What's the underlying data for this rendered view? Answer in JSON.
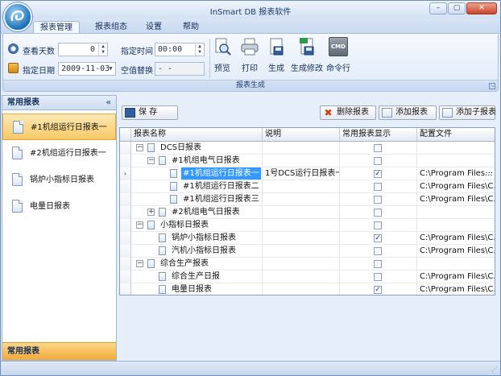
{
  "window": {
    "title": "InSmart DB 报表软件",
    "min": "–",
    "max": "▢",
    "close": "✕"
  },
  "ribbon": {
    "tabs": [
      {
        "label": "报表管理",
        "active": true
      },
      {
        "label": "报表组态",
        "active": false
      },
      {
        "label": "设置",
        "active": false
      },
      {
        "label": "帮助",
        "active": false
      }
    ],
    "group_label": "报表生成",
    "query_days_label": "查看天数",
    "query_days_value": "0",
    "date_label": "指定日期",
    "date_value": "2009-11-03",
    "time_label": "指定时间",
    "time_value": "00:00",
    "null_label": "空值替换",
    "null_value": "- -",
    "buttons": {
      "preview": "预览",
      "print": "打印",
      "generate": "生成",
      "generate_edit": "生成修改",
      "command": "命令行",
      "command_icon_text": "CMD"
    }
  },
  "left_panel": {
    "header": "常用报表",
    "collapse": "«",
    "items": [
      {
        "label": "#1机组运行日报表一",
        "active": true
      },
      {
        "label": "#2机组运行日报表一",
        "active": false
      },
      {
        "label": "锅炉小指标日报表",
        "active": false
      },
      {
        "label": "电量日报表",
        "active": false
      }
    ],
    "footer": "常用报表"
  },
  "toolbar": {
    "save": "保  存",
    "delete": "删除报表",
    "add": "添加报表",
    "add_child": "添加子报表"
  },
  "grid": {
    "columns": [
      "报表名称",
      "说明",
      "常用报表显示",
      "配置文件"
    ],
    "rows": [
      {
        "name": "DCS日报表",
        "desc": "",
        "checked": false,
        "config": ""
      },
      {
        "name": "#1机组电气日报表",
        "desc": "",
        "checked": false,
        "config": ""
      },
      {
        "name": "#1机组运行日报表一",
        "desc": "1号DCS运行日报表一",
        "checked": true,
        "config": "C:\\Program Files...",
        "ellipsis": "···"
      },
      {
        "name": "#1机组运行日报表二",
        "desc": "",
        "checked": false,
        "config": "C:\\Program Files\\C..."
      },
      {
        "name": "#1机组运行日报表三",
        "desc": "",
        "checked": false,
        "config": "C:\\Program Files\\C..."
      },
      {
        "name": "#2机组电气日报表",
        "desc": "",
        "checked": false,
        "config": ""
      },
      {
        "name": "小指标日报表",
        "desc": "",
        "checked": false,
        "config": ""
      },
      {
        "name": "锅炉小指标日报表",
        "desc": "",
        "checked": true,
        "config": "C:\\Program Files\\C..."
      },
      {
        "name": "汽机小指标日报表",
        "desc": "",
        "checked": false,
        "config": "C:\\Program Files\\C..."
      },
      {
        "name": "综合生产报表",
        "desc": "",
        "checked": false,
        "config": ""
      },
      {
        "name": "综合生产日报",
        "desc": "",
        "checked": false,
        "config": "C:\\Program Files\\C..."
      },
      {
        "name": "电量日报表",
        "desc": "",
        "checked": true,
        "config": "C:\\Program Files\\C..."
      }
    ],
    "row_pointer": "›",
    "expand_minus": "−",
    "expand_plus": "+",
    "check_mark": "✓"
  },
  "colors": {
    "accent": "#3399ff",
    "active_item": "#f8c966",
    "frame": "#6d8fbf"
  },
  "icons": [
    "app-logo-icon",
    "eye-icon",
    "calendar-icon",
    "preview-icon",
    "printer-icon",
    "generate-icon",
    "generate-edit-icon",
    "cmd-icon",
    "save-icon",
    "delete-icon",
    "add-report-icon",
    "add-child-icon",
    "document-icon"
  ]
}
